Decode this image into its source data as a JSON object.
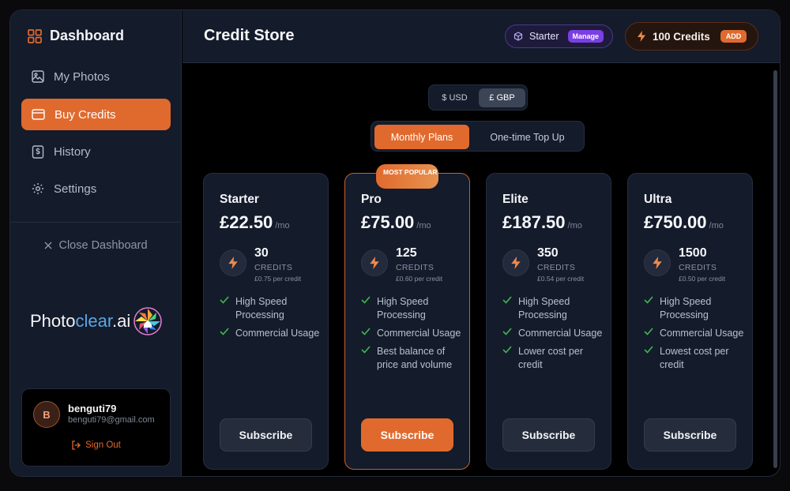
{
  "sidebar": {
    "brand": "Dashboard",
    "items": [
      {
        "label": "My Photos",
        "icon": "image-icon"
      },
      {
        "label": "Buy Credits",
        "icon": "credit-card-icon",
        "active": true
      },
      {
        "label": "History",
        "icon": "receipt-icon"
      },
      {
        "label": "Settings",
        "icon": "gear-icon"
      }
    ],
    "close_label": "Close Dashboard",
    "logo": {
      "part1": "Photo",
      "part2": "clear",
      "part3": ".ai"
    },
    "user": {
      "initial": "B",
      "name": "benguti79",
      "email": "benguti79@gmail.com",
      "sign_out": "Sign Out"
    }
  },
  "header": {
    "title": "Credit Store",
    "plan_name": "Starter",
    "manage_label": "Manage",
    "credits_label": "100 Credits",
    "add_label": "ADD"
  },
  "currency": {
    "options": [
      "$ USD",
      "£ GBP"
    ],
    "selected": "£ GBP"
  },
  "plan_type": {
    "options": [
      "Monthly Plans",
      "One-time Top Up"
    ],
    "selected": "Monthly Plans"
  },
  "plans": [
    {
      "name": "Starter",
      "price": "£22.50",
      "period": "/mo",
      "credits": "30",
      "credits_label": "CREDITS",
      "per_credit": "£0.75 per credit",
      "features": [
        "High Speed Processing",
        "Commercial Usage"
      ],
      "button": "Subscribe"
    },
    {
      "name": "Pro",
      "price": "£75.00",
      "period": "/mo",
      "credits": "125",
      "credits_label": "CREDITS",
      "per_credit": "£0.60 per credit",
      "features": [
        "High Speed Processing",
        "Commercial Usage",
        "Best balance of price and volume"
      ],
      "button": "Subscribe",
      "badge": "MOST POPULAR"
    },
    {
      "name": "Elite",
      "price": "£187.50",
      "period": "/mo",
      "credits": "350",
      "credits_label": "CREDITS",
      "per_credit": "£0.54 per credit",
      "features": [
        "High Speed Processing",
        "Commercial Usage",
        "Lower cost per credit"
      ],
      "button": "Subscribe"
    },
    {
      "name": "Ultra",
      "price": "£750.00",
      "period": "/mo",
      "credits": "1500",
      "credits_label": "CREDITS",
      "per_credit": "£0.50 per credit",
      "features": [
        "High Speed Processing",
        "Commercial Usage",
        "Lowest cost per credit"
      ],
      "button": "Subscribe"
    }
  ],
  "colors": {
    "accent": "#e06a2e",
    "panel": "#141b2b",
    "background": "#000000",
    "check": "#3fb950",
    "manage": "#7b3fe4"
  }
}
